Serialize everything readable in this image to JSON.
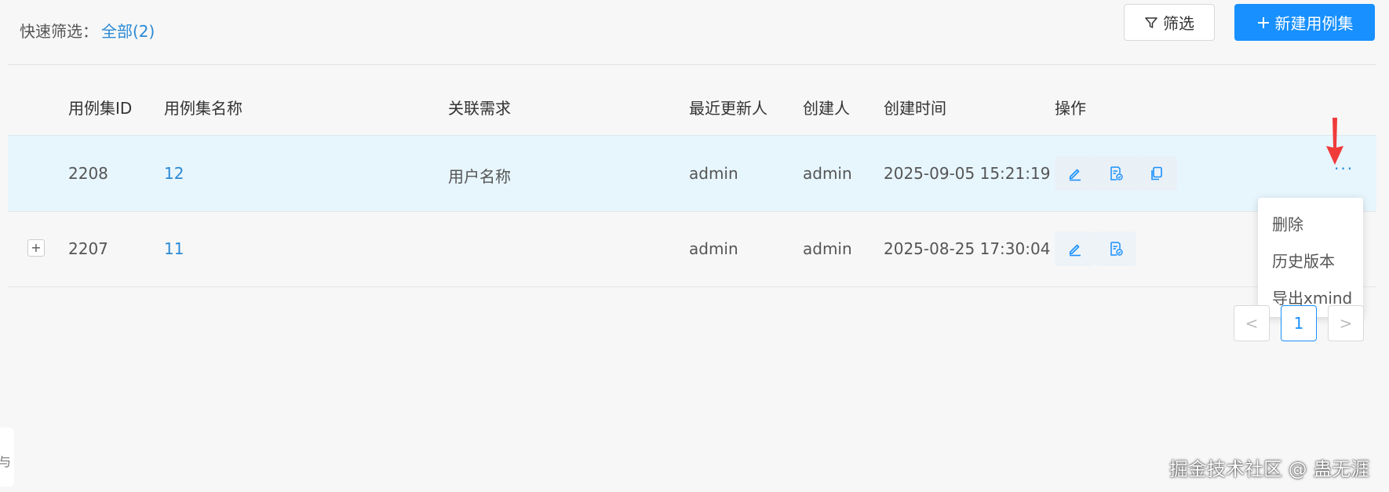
{
  "toolbar": {
    "quick_filter_label": "快速筛选：",
    "quick_filter_all": "全部(2)",
    "filter_button": "筛选",
    "new_button": "新建用例集"
  },
  "table": {
    "headers": [
      "用例集ID",
      "用例集名称",
      "关联需求",
      "最近更新人",
      "创建人",
      "创建时间",
      "操作"
    ],
    "rows": [
      {
        "id": "2208",
        "name": "12",
        "requirement": "用户名称",
        "updater": "admin",
        "creator": "admin",
        "created": "2025-09-05 15:21:19"
      },
      {
        "id": "2207",
        "name": "11",
        "requirement": "",
        "updater": "admin",
        "creator": "admin",
        "created": "2025-08-25 17:30:04"
      }
    ],
    "expand_symbol": "+",
    "more_symbol": "···"
  },
  "dropdown": {
    "items": [
      "删除",
      "历史版本",
      "导出xmind"
    ]
  },
  "pagination": {
    "prev": "<",
    "current": "1",
    "next": ">"
  },
  "left_edge_text": "与",
  "watermark": "掘金技术社区 @ 蛊无涯",
  "colors": {
    "accent": "#1890ff",
    "link": "#2a8ad6",
    "row_highlight": "#e7f5fd",
    "annotation_arrow": "#f03a3a"
  }
}
